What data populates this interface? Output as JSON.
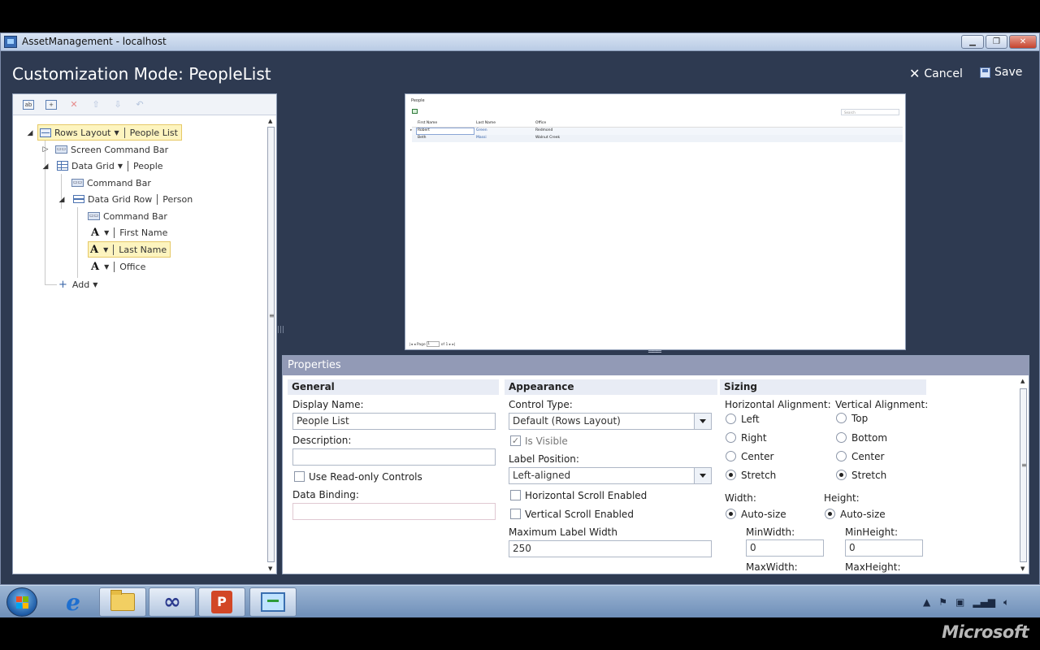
{
  "window": {
    "title": "AssetManagement - localhost",
    "minimize": "▁",
    "maximize": "❐",
    "close": "✕"
  },
  "header": {
    "mode_title": "Customization Mode: PeopleList",
    "cancel_label": "Cancel",
    "save_label": "Save"
  },
  "tree": {
    "root": {
      "label": "Rows Layout",
      "name": "People List"
    },
    "screen_command_bar": "Screen Command Bar",
    "data_grid": {
      "label": "Data Grid",
      "name": "People"
    },
    "grid_command_bar": "Command Bar",
    "data_grid_row": {
      "label": "Data Grid Row",
      "name": "Person"
    },
    "row_command_bar": "Command Bar",
    "fields": [
      "First Name",
      "Last Name",
      "Office"
    ],
    "add_label": "Add"
  },
  "preview": {
    "title": "People",
    "search_placeholder": "Search",
    "columns": [
      "First Name",
      "Last Name",
      "Office"
    ],
    "rows": [
      [
        "Robert",
        "Green",
        "Redmond"
      ],
      [
        "Beth",
        "Massi",
        "Walnut Creek"
      ]
    ],
    "pager": {
      "page_label": "Page",
      "page": "1",
      "of_label": "of 1"
    }
  },
  "properties": {
    "header": "Properties",
    "general": {
      "title": "General",
      "display_name_label": "Display Name:",
      "display_name_value": "People List",
      "description_label": "Description:",
      "description_value": "",
      "readonly_label": "Use Read-only Controls",
      "data_binding_label": "Data Binding:",
      "data_binding_value": ""
    },
    "appearance": {
      "title": "Appearance",
      "control_type_label": "Control Type:",
      "control_type_value": "Default (Rows Layout)",
      "is_visible_label": "Is Visible",
      "label_position_label": "Label Position:",
      "label_position_value": "Left-aligned",
      "hscroll_label": "Horizontal Scroll Enabled",
      "vscroll_label": "Vertical Scroll Enabled",
      "max_label_width_label": "Maximum Label Width",
      "max_label_width_value": "250"
    },
    "sizing": {
      "title": "Sizing",
      "halign_label": "Horizontal Alignment:",
      "halign_options": [
        "Left",
        "Right",
        "Center",
        "Stretch"
      ],
      "halign_selected": "Stretch",
      "valign_label": "Vertical Alignment:",
      "valign_options": [
        "Top",
        "Bottom",
        "Center",
        "Stretch"
      ],
      "valign_selected": "Stretch",
      "width_label": "Width:",
      "width_mode": "Auto-size",
      "height_label": "Height:",
      "height_mode": "Auto-size",
      "minwidth_label": "MinWidth:",
      "minwidth_value": "0",
      "minheight_label": "MinHeight:",
      "minheight_value": "0",
      "maxwidth_label": "MaxWidth:",
      "maxheight_label": "MaxHeight:"
    }
  },
  "watermark": "Microsoft"
}
